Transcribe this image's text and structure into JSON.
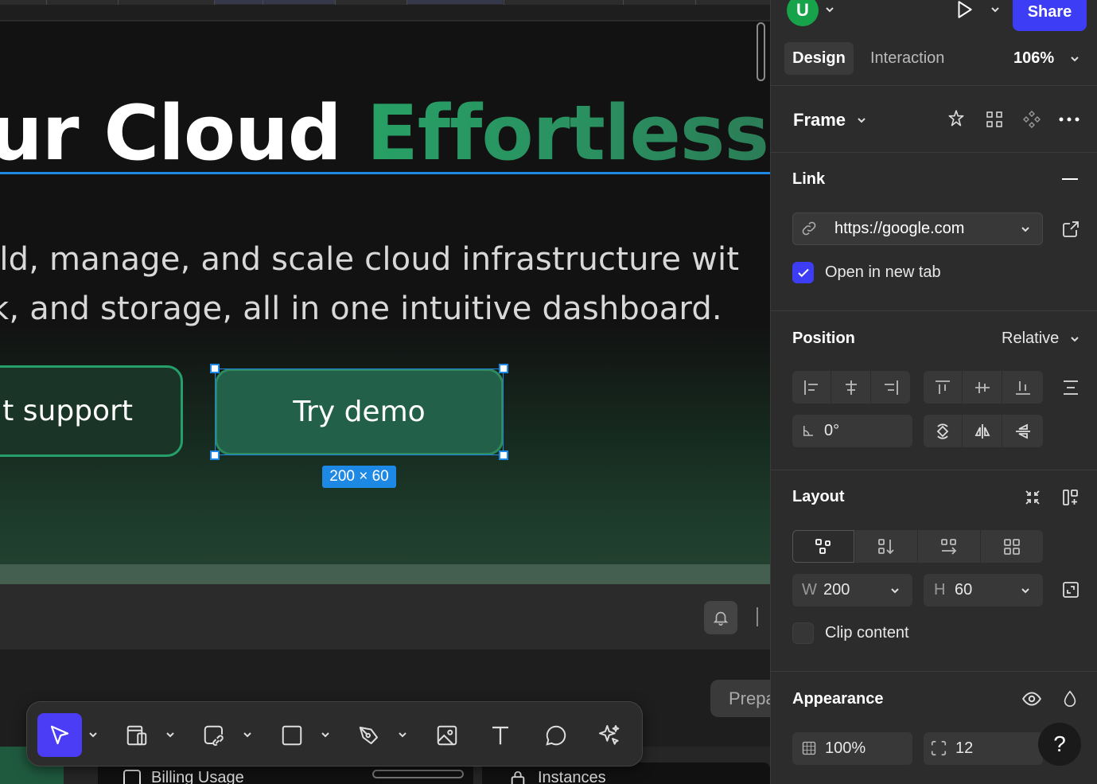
{
  "canvas": {
    "headline_white": "ur Cloud ",
    "headline_green": "Effortlessl",
    "subline1": "ild, manage, and scale cloud infrastructure wit",
    "subline2": "k, and storage, all in one intuitive dashboard.",
    "button_support": "t support",
    "button_demo": "Try demo",
    "dimension_badge": "200 × 60",
    "prep_chip": "Prepa",
    "billing_tab": "Billing Usage",
    "instances_tab": "Instances",
    "colors": {
      "accent_green": "#27a065",
      "selection_blue": "#1e88e5",
      "demo_fill": "#226049"
    }
  },
  "toolbar": {
    "tools": [
      {
        "name": "select-tool",
        "icon": "cursor-arrow-icon",
        "active": true,
        "has_caret": true
      },
      {
        "name": "device-frame-tool",
        "icon": "device-frame-icon",
        "has_caret": true
      },
      {
        "name": "link-shape-tool",
        "icon": "link-shape-icon",
        "has_caret": true
      },
      {
        "name": "rectangle-tool",
        "icon": "rectangle-icon",
        "has_caret": true
      },
      {
        "name": "pen-tool",
        "icon": "pen-nib-icon",
        "has_caret": true
      },
      {
        "name": "image-tool",
        "icon": "image-icon"
      },
      {
        "name": "text-tool",
        "icon": "text-T-icon"
      },
      {
        "name": "comment-tool",
        "icon": "comment-bubble-icon"
      },
      {
        "name": "ai-tool",
        "icon": "sparkle-cursor-icon"
      }
    ]
  },
  "panel": {
    "avatar_letter": "U",
    "share_label": "Share",
    "tabs": {
      "design": "Design",
      "interaction": "Interaction"
    },
    "zoom": "106%",
    "frame_label": "Frame",
    "link": {
      "title": "Link",
      "url": "https://google.com",
      "open_new_tab_label": "Open in new tab",
      "open_new_tab_checked": true
    },
    "position": {
      "title": "Position",
      "mode": "Relative",
      "rotation": "0°"
    },
    "layout": {
      "title": "Layout",
      "width_label": "W",
      "width": "200",
      "height_label": "H",
      "height": "60",
      "clip_content_label": "Clip content",
      "clip_content_checked": false
    },
    "appearance": {
      "title": "Appearance",
      "opacity": "100%",
      "radius": "12"
    },
    "help_label": "?",
    "colors": {
      "brand_blue": "#3d3df5",
      "avatar_green": "#16a34a"
    }
  }
}
